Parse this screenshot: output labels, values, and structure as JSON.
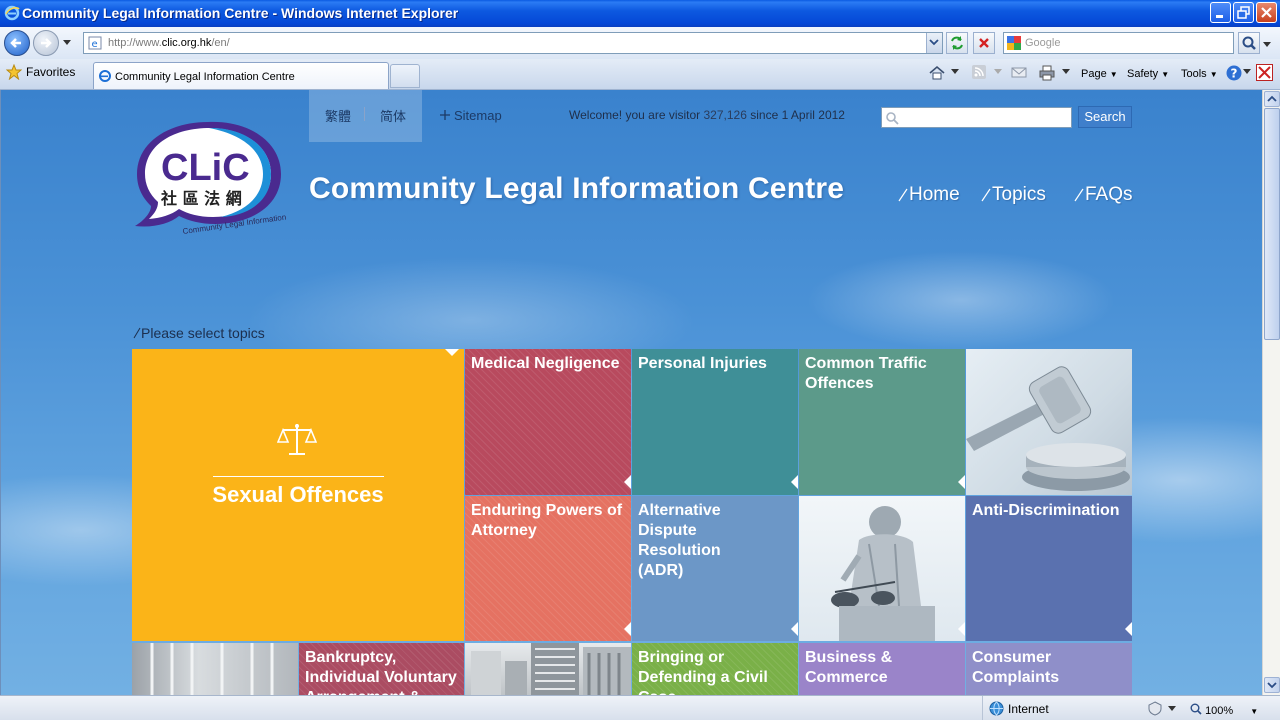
{
  "window": {
    "title": "Community Legal Information Centre - Windows Internet Explorer",
    "address_base": "http://www.",
    "address_domain": "clic.org.hk",
    "address_path": "/en/",
    "search_placeholder": "Google"
  },
  "toolbar": {
    "favorites_label": "Favorites",
    "tab_title": "Community Legal Information Centre",
    "page_label": "Page",
    "safety_label": "Safety",
    "tools_label": "Tools"
  },
  "status": {
    "zone": "Internet",
    "zoom": "100%"
  },
  "site": {
    "lang_traditional": "繁體",
    "lang_simplified": "简体",
    "sitemap": "Sitemap",
    "visitor_prefix": "Welcome! you are visitor",
    "visitor_count": "327,126",
    "visitor_suffix": "since 1 April 2012",
    "search_button": "Search",
    "logo_text": "CLiC",
    "logo_chinese": "社 區 法 網",
    "logo_subtitle": "Community Legal Information Centre",
    "title": "Community Legal Information Centre",
    "nav": [
      "Home",
      "Topics",
      "FAQs"
    ],
    "select_topics": "Please select topics"
  },
  "tiles": {
    "sexual_offences": "Sexual Offences",
    "medical_negligence": "Medical Negligence",
    "personal_injuries": "Personal Injuries",
    "common_traffic": "Common Traffic Offences",
    "enduring_powers": "Enduring Powers of Attorney",
    "adr": "Alternative Dispute Resolution (ADR)",
    "anti_discrimination": "Anti-Discrimination",
    "bankruptcy": "Bankruptcy, Individual Voluntary Arrangement &",
    "civil_case": "Bringing or Defending a Civil Case",
    "business": "Business & Commerce",
    "consumer": "Consumer Complaints"
  },
  "colors": {
    "sexual_offences": "#fbb418",
    "medical_negligence": "#b84a5e",
    "personal_injuries": "#3f8f97",
    "common_traffic": "#5c9a8a",
    "enduring_powers": "#e57262",
    "adr": "#6c97c7",
    "anti_discrimination": "#5a71af",
    "bankruptcy": "#ab4c62",
    "civil_case": "#7ab048",
    "business": "#9a84c9",
    "consumer": "#8f8fc9"
  }
}
